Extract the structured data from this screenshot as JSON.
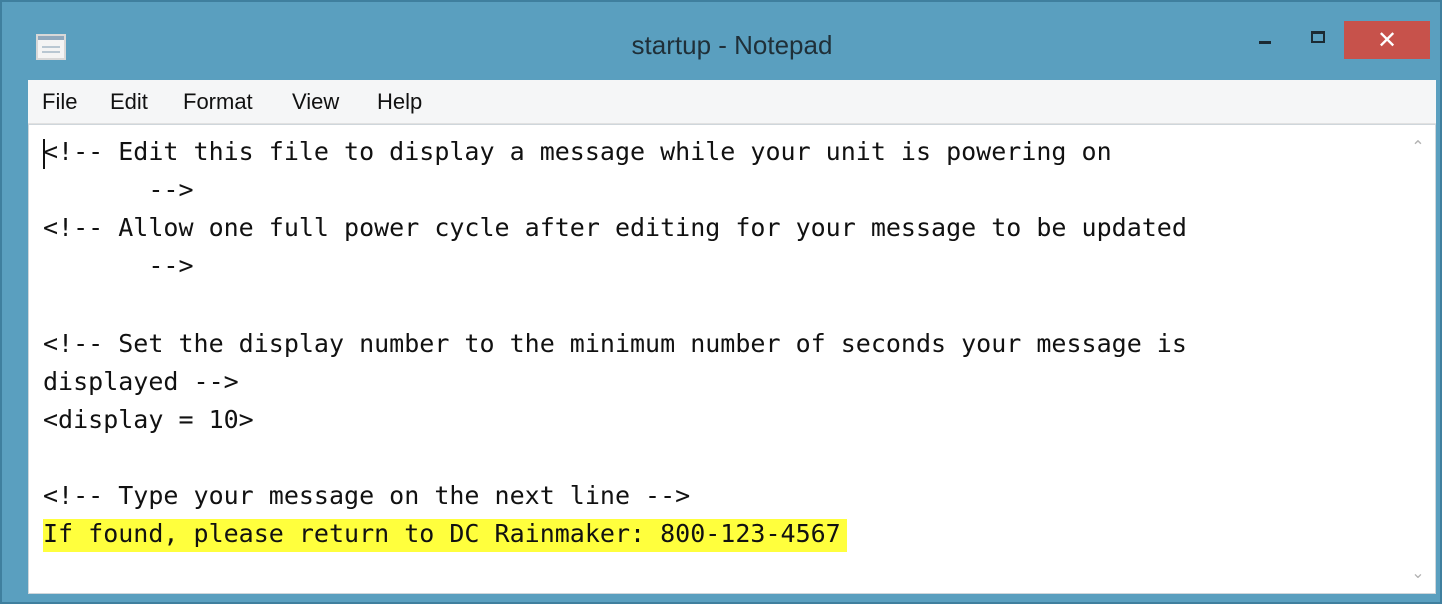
{
  "window": {
    "title": "startup - Notepad",
    "close_glyph": "✕"
  },
  "menu": {
    "items": [
      "File",
      "Edit",
      "Format",
      "View",
      "Help"
    ]
  },
  "editor": {
    "lines": [
      "<!-- Edit this file to display a message while your unit is powering on",
      "       -->",
      "<!-- Allow one full power cycle after editing for your message to be updated",
      "       -->",
      "<!-- Set the display number to the minimum number of seconds your message is",
      "displayed -->",
      "<display = 10>",
      "<!-- Type your message on the next line -->",
      "If found, please return to DC Rainmaker: 800-123-4567"
    ]
  },
  "scrollbar": {
    "up_glyph": "⌃",
    "down_glyph": "⌄"
  },
  "colors": {
    "title_bar": "#5a9fbf",
    "close_button": "#c7524b",
    "highlight": "#ffff3d"
  },
  "icons": [
    "notepad-app-icon",
    "minimize-icon",
    "maximize-icon",
    "close-icon",
    "scroll-up-arrow-icon",
    "scroll-down-arrow-icon"
  ]
}
